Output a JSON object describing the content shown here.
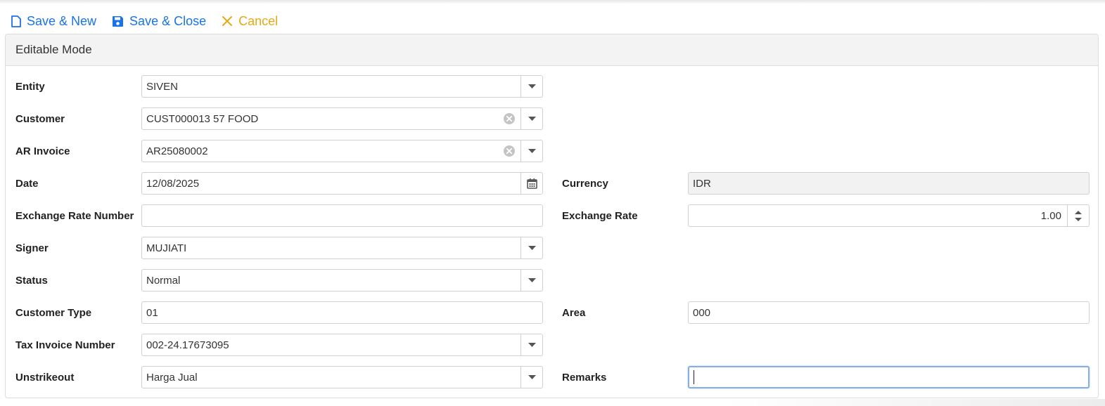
{
  "toolbar": {
    "save_new": "Save & New",
    "save_close": "Save & Close",
    "cancel": "Cancel"
  },
  "panel": {
    "title": "Editable Mode"
  },
  "form": {
    "entity": {
      "label": "Entity",
      "value": "SIVEN"
    },
    "customer": {
      "label": "Customer",
      "value": "CUST000013 57 FOOD"
    },
    "ar_invoice": {
      "label": "AR Invoice",
      "value": "AR25080002"
    },
    "date": {
      "label": "Date",
      "value": "12/08/2025"
    },
    "currency": {
      "label": "Currency",
      "value": "IDR"
    },
    "exchange_rate_number": {
      "label": "Exchange Rate Number",
      "value": ""
    },
    "exchange_rate": {
      "label": "Exchange Rate",
      "value": "1.00"
    },
    "signer": {
      "label": "Signer",
      "value": "MUJIATI"
    },
    "status": {
      "label": "Status",
      "value": "Normal"
    },
    "customer_type": {
      "label": "Customer Type",
      "value": "01"
    },
    "area": {
      "label": "Area",
      "value": "000"
    },
    "tax_invoice_number": {
      "label": "Tax Invoice Number",
      "value": "002-24.17673095"
    },
    "unstrikeout": {
      "label": "Unstrikeout",
      "value": "Harga Jual"
    },
    "remarks": {
      "label": "Remarks",
      "value": ""
    }
  },
  "colors": {
    "accent": "#1a73e8",
    "cancel": "#e6a817",
    "focus_border": "#86aee0"
  },
  "icons": {
    "save_new": "new-document-icon",
    "save_close": "floppy-disk-icon",
    "cancel": "x-icon",
    "dropdown": "chevron-down-icon",
    "clear": "clear-circle-icon",
    "calendar": "calendar-icon",
    "spinner": "spinner-arrows-icon"
  }
}
